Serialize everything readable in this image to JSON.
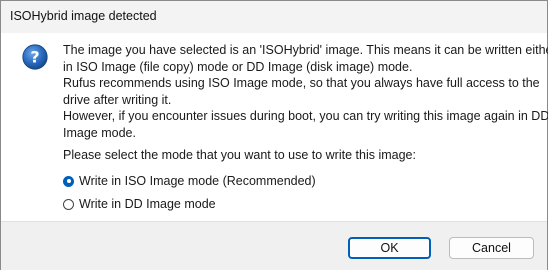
{
  "window": {
    "title": "ISOHybrid image detected"
  },
  "icon": {
    "name": "question-icon",
    "color": "#1f5fa8"
  },
  "message": {
    "lines": [
      "The image you have selected is an 'ISOHybrid' image. This means it can be written either",
      "in ISO Image (file copy) mode or DD Image (disk image) mode.",
      "Rufus recommends using ISO Image mode, so that you always have full access to the",
      "drive after writing it.",
      "However, if you encounter issues during boot, you can try writing this image again in DD",
      "Image mode."
    ]
  },
  "prompt": "Please select the mode that you want to use to write this image:",
  "options": [
    {
      "label": "Write in ISO Image mode (Recommended)",
      "selected": true
    },
    {
      "label": "Write in DD Image mode",
      "selected": false
    }
  ],
  "buttons": {
    "ok": "OK",
    "cancel": "Cancel"
  },
  "colors": {
    "accent": "#005fb8",
    "footer_bg": "#f0f0f0"
  }
}
